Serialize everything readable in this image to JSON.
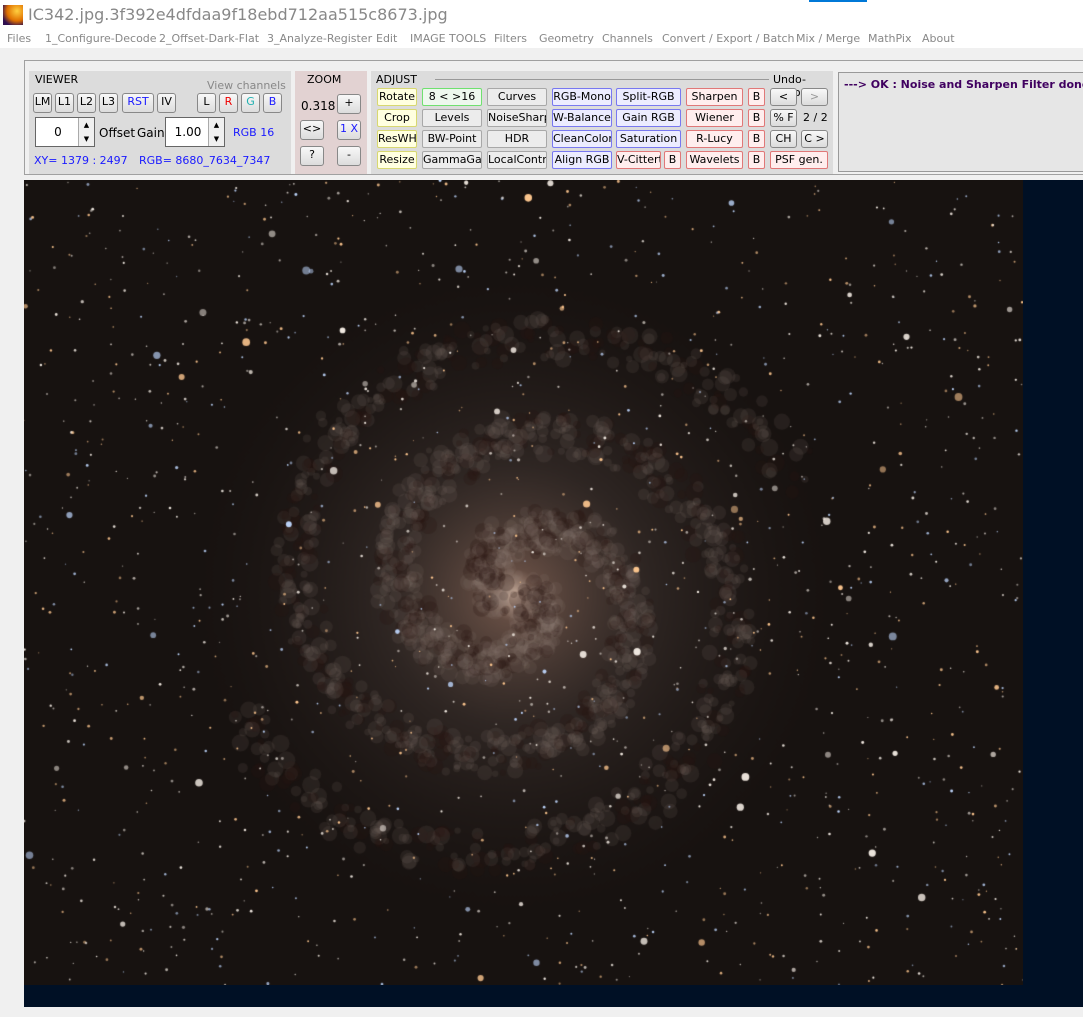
{
  "window": {
    "title": "IC342.jpg.3f392e4dfdaa9f18ebd712aa515c8673.jpg"
  },
  "menu": [
    "Files",
    "1_Configure-Decode",
    "2_Offset-Dark-Flat",
    "3_Analyze-Register",
    "Edit",
    "IMAGE TOOLS",
    "Filters",
    "Geometry",
    "Channels",
    "Convert / Export / Batch",
    "Mix / Merge",
    "MathPix",
    "About"
  ],
  "viewer": {
    "title": "VIEWER",
    "view_channels": "View channels",
    "buttons": [
      "LM",
      "L1",
      "L2",
      "L3",
      "RST",
      "IV"
    ],
    "channels": [
      "L",
      "R",
      "G",
      "B"
    ],
    "offset_value": "0",
    "offset_label": "Offset",
    "gain_label": "Gain",
    "gain_value": "1.00",
    "bit_depth": "RGB 16",
    "xy": "XY=  1379 : 2497",
    "rgb": "RGB=  8680_7634_7347"
  },
  "zoom": {
    "title": "ZOOM",
    "value": "0.318",
    "plus": "+",
    "fit": "<>",
    "one_x": "1 X",
    "help": "?",
    "minus": "-"
  },
  "adjust": {
    "title": "ADJUST",
    "undo_redo": "Undo-Redo",
    "col1": [
      "Rotate",
      "Crop",
      "ResWH",
      "Resize"
    ],
    "col2": [
      "8 < >16",
      "Levels",
      "BW-Point",
      "GammaGain"
    ],
    "col3": [
      "Curves",
      "NoiseSharp",
      "HDR",
      "LocalContr"
    ],
    "col4": [
      "RGB-Mono",
      "W-Balance",
      "CleanColor",
      "Align RGB"
    ],
    "col5": [
      "Split-RGB",
      "Gain RGB",
      "Saturation",
      "V-Cittert"
    ],
    "col6": [
      "Sharpen",
      "Wiener",
      "R-Lucy",
      "Wavelets"
    ],
    "b": "B",
    "undo": "<",
    "redo": ">",
    "pct_f": "% F",
    "counter": "2 / 2",
    "ch": "CH",
    "c_next": "C >",
    "psf": "PSF gen."
  },
  "status": {
    "message": "---> OK :   Noise and Sharpen Filter done !"
  },
  "colors": {
    "accent": "#0078d7",
    "blue_text": "#1a1aff",
    "message": "#400060",
    "image_bg": "#001025"
  }
}
